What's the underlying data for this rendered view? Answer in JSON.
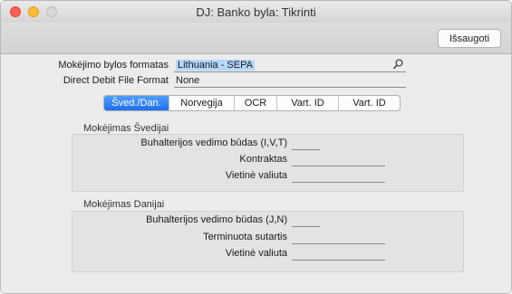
{
  "window": {
    "title": "DJ: Banko byla: Tikrinti",
    "controls": [
      "close",
      "minimize",
      "zoom"
    ]
  },
  "toolbar": {
    "save_label": "Išsaugoti"
  },
  "form": {
    "payment_format_label": "Mokėjimo bylos formatas",
    "payment_format_value": "Lithuania - SEPA",
    "direct_debit_label": "Direct Debit File Format",
    "direct_debit_value": "None"
  },
  "tabs": [
    {
      "label": "Šved./Dan.",
      "active": true
    },
    {
      "label": "Norvegija",
      "active": false
    },
    {
      "label": "OCR",
      "active": false
    },
    {
      "label": "Vart. ID",
      "active": false
    },
    {
      "label": "Vart. ID",
      "active": false
    }
  ],
  "sweden": {
    "title": "Mokėjimas Švedijai",
    "accounting_label": "Buhalterijos vedimo būdas (I,V,T)",
    "accounting_value": "",
    "contract_label": "Kontraktas",
    "contract_value": "",
    "currency_label": "Vietinė valiuta",
    "currency_value": ""
  },
  "denmark": {
    "title": "Mokėjimas Danijai",
    "accounting_label": "Buhalterijos vedimo būdas (J,N)",
    "accounting_value": "",
    "term_contract_label": "Terminuota sutartis",
    "term_contract_value": "",
    "currency_label": "Vietinė valiuta",
    "currency_value": ""
  },
  "icons": {
    "lookup": "magnifier-icon"
  },
  "colors": {
    "active_tab": "#1e70ee",
    "selection": "#b3d7ff",
    "close": "#fc5f57",
    "minimize": "#fdbc2e",
    "zoom": "#d9d9d9"
  }
}
